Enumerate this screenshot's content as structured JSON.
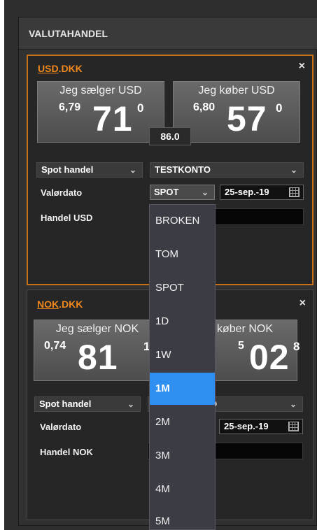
{
  "panel": {
    "title": "VALUTAHANDEL"
  },
  "pairs": [
    {
      "base": "USD",
      "quote_suffix": ".DKK",
      "close": "×",
      "sell": {
        "label": "Jeg sælger USD",
        "small": "6,79",
        "big": "71",
        "sup": "0"
      },
      "buy": {
        "label": "Jeg køber USD",
        "small": "6,80",
        "big": "57",
        "sup": "0"
      },
      "spread": "86.0",
      "trade_type": "Spot handel",
      "account": "TESTKONTO",
      "value_date_label": "Valørdato",
      "value_date_mode": "SPOT",
      "value_date": "25-sep.-19",
      "trade_label": "Handel USD"
    },
    {
      "base": "NOK",
      "quote_suffix": ".DKK",
      "close": "×",
      "sell": {
        "label": "Jeg sælger NOK",
        "small": "0,74",
        "big": "81",
        "sup": "1"
      },
      "buy": {
        "label": "køber NOK",
        "small": "5",
        "big": "02",
        "sup": "8"
      },
      "trade_type": "Spot handel",
      "account": "O",
      "value_date_label": "Valørdato",
      "value_date": "25-sep.-19",
      "trade_label": "Handel NOK"
    }
  ],
  "dropdown": {
    "options": [
      "BROKEN",
      "TOM",
      "SPOT",
      "1D",
      "1W",
      "1M",
      "2M",
      "3M",
      "4M",
      "5M"
    ],
    "selected_index": 5
  },
  "icons": {
    "chevron": "chevron-down-icon",
    "calendar": "calendar-icon",
    "close": "close-icon"
  },
  "colors": {
    "accent": "#f0881e",
    "selected": "#2f8ff0",
    "border_active": "#c96f17"
  }
}
